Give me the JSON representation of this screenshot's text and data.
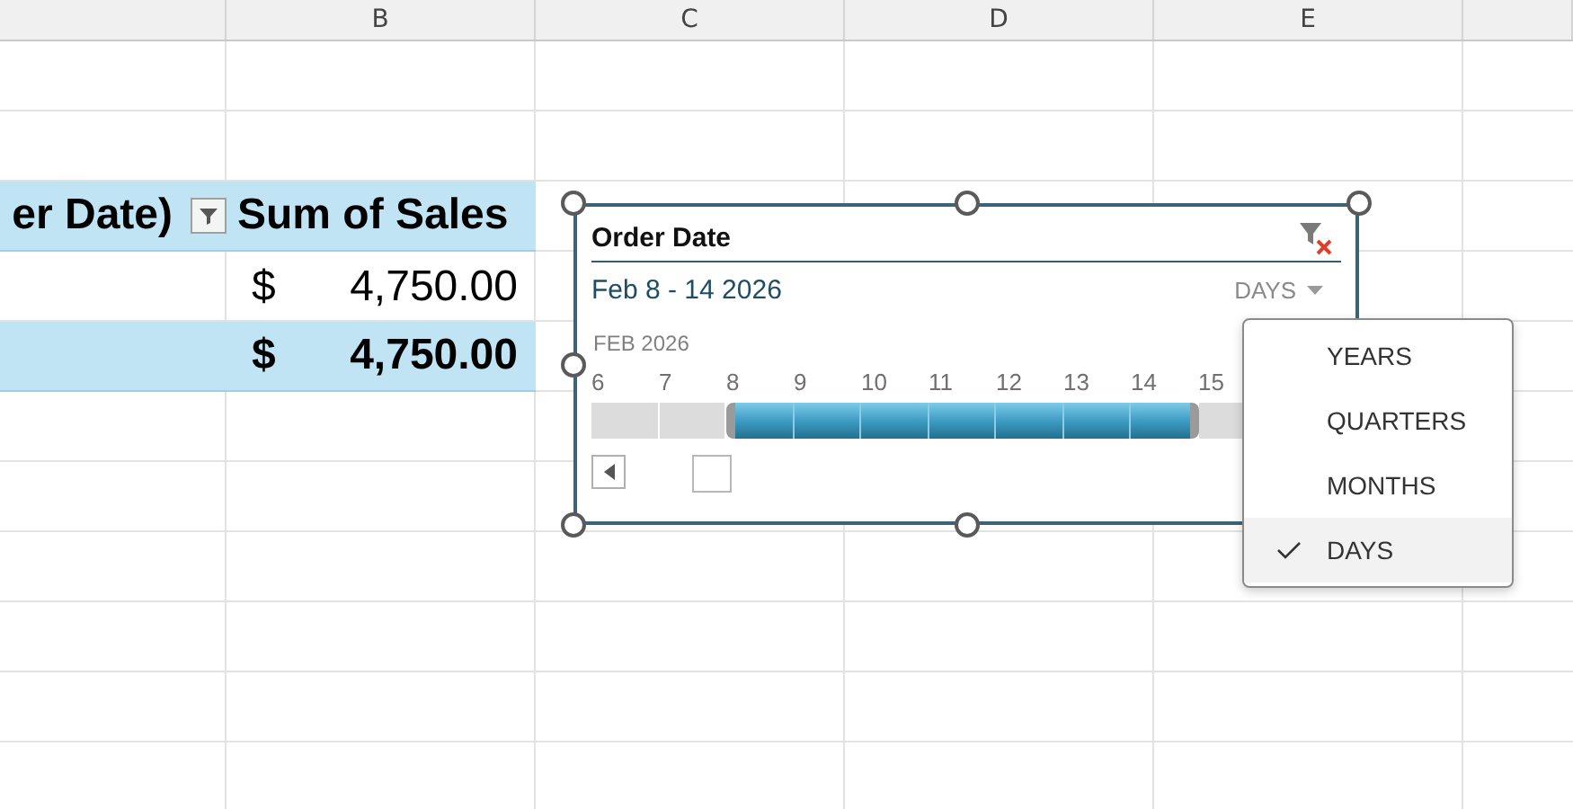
{
  "columns": [
    "B",
    "C",
    "D",
    "E"
  ],
  "pivot": {
    "header": [
      "er Date)",
      "Sum of Sales"
    ],
    "rows": [
      {
        "kind": "data",
        "currency": "$",
        "amount": "4,750.00"
      },
      {
        "kind": "total",
        "currency": "$",
        "amount": "4,750.00"
      }
    ]
  },
  "timeline": {
    "title": "Order Date",
    "range": "Feb 8 - 14 2026",
    "level": "DAYS",
    "period": "FEB 2026",
    "days": [
      {
        "label": "6",
        "selected": false
      },
      {
        "label": "7",
        "selected": false
      },
      {
        "label": "8",
        "selected": true
      },
      {
        "label": "9",
        "selected": true
      },
      {
        "label": "10",
        "selected": true
      },
      {
        "label": "11",
        "selected": true
      },
      {
        "label": "12",
        "selected": true
      },
      {
        "label": "13",
        "selected": true
      },
      {
        "label": "14",
        "selected": true
      },
      {
        "label": "15",
        "selected": false
      }
    ]
  },
  "level_menu": {
    "items": [
      {
        "label": "YEARS",
        "selected": false
      },
      {
        "label": "QUARTERS",
        "selected": false
      },
      {
        "label": "MONTHS",
        "selected": false
      },
      {
        "label": "DAYS",
        "selected": true
      }
    ]
  }
}
